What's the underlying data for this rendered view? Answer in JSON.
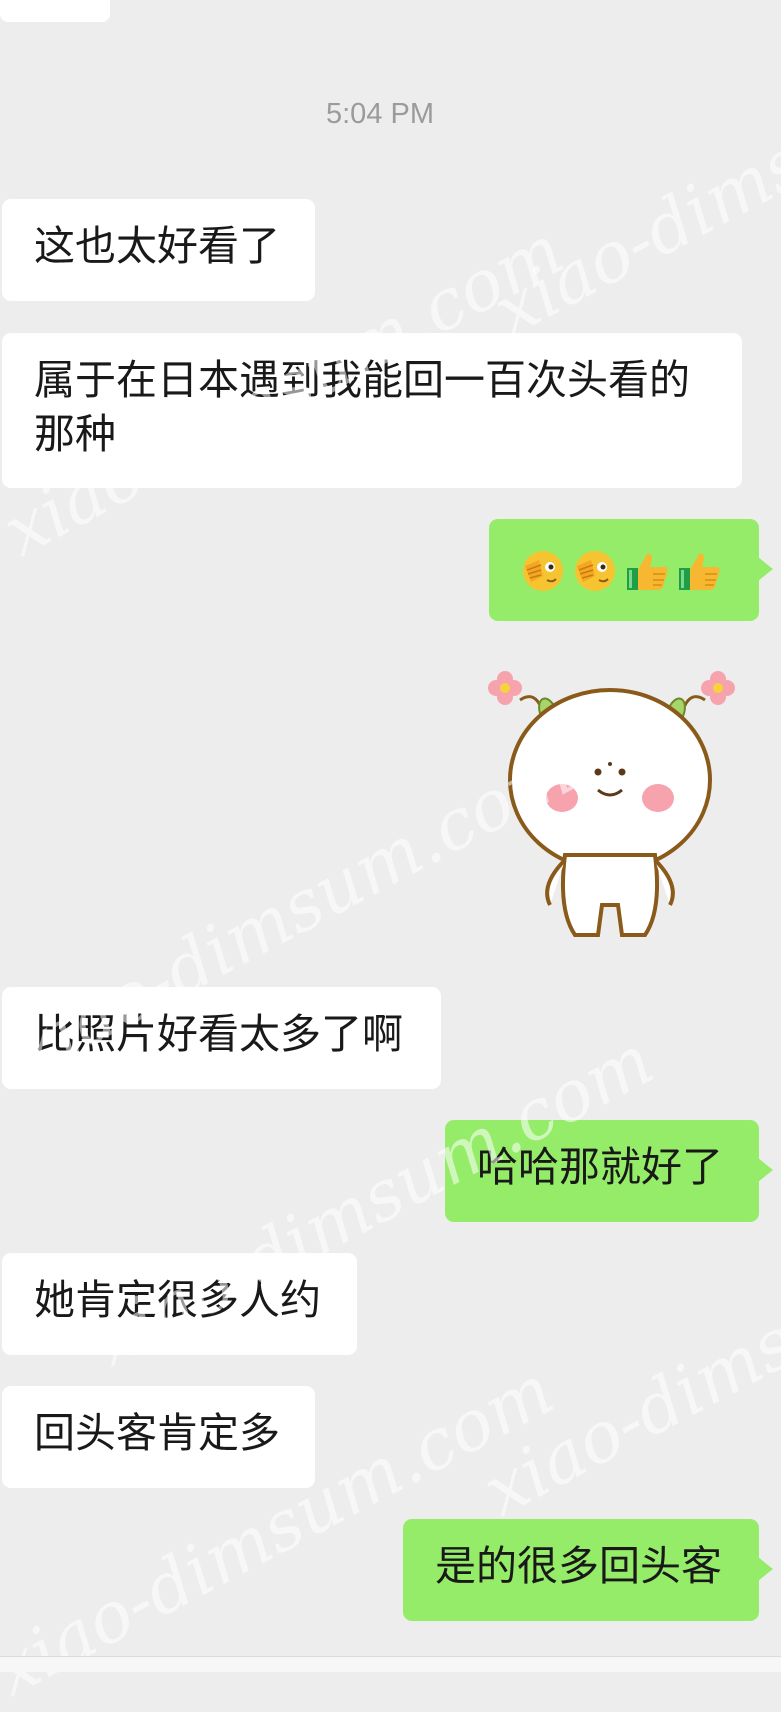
{
  "chat": {
    "timestamp": "5:04 PM",
    "messages": [
      {
        "side": "in",
        "text": "这也太好看了"
      },
      {
        "side": "in",
        "text": "属于在日本遇到我能回一百次头看的那种"
      },
      {
        "side": "out",
        "type": "emoji",
        "emojis": [
          "facepalm-peek-emoji",
          "facepalm-peek-emoji",
          "thumbs-up-emoji",
          "thumbs-up-emoji"
        ]
      },
      {
        "side": "out",
        "type": "sticker",
        "sticker": "cute-bun-character-sticker"
      },
      {
        "side": "in",
        "text": "比照片好看太多了啊"
      },
      {
        "side": "out",
        "text": "哈哈那就好了"
      },
      {
        "side": "in",
        "text": "她肯定很多人约"
      },
      {
        "side": "in",
        "text": "回头客肯定多"
      },
      {
        "side": "out",
        "text": "是的很多回头客"
      }
    ]
  },
  "watermark": {
    "text": "xiao-dimsum.com"
  },
  "colors": {
    "background": "#ededed",
    "incoming_bubble": "#ffffff",
    "outgoing_bubble": "#95ec69",
    "text": "#191919",
    "timestamp": "#9b9b9b"
  }
}
